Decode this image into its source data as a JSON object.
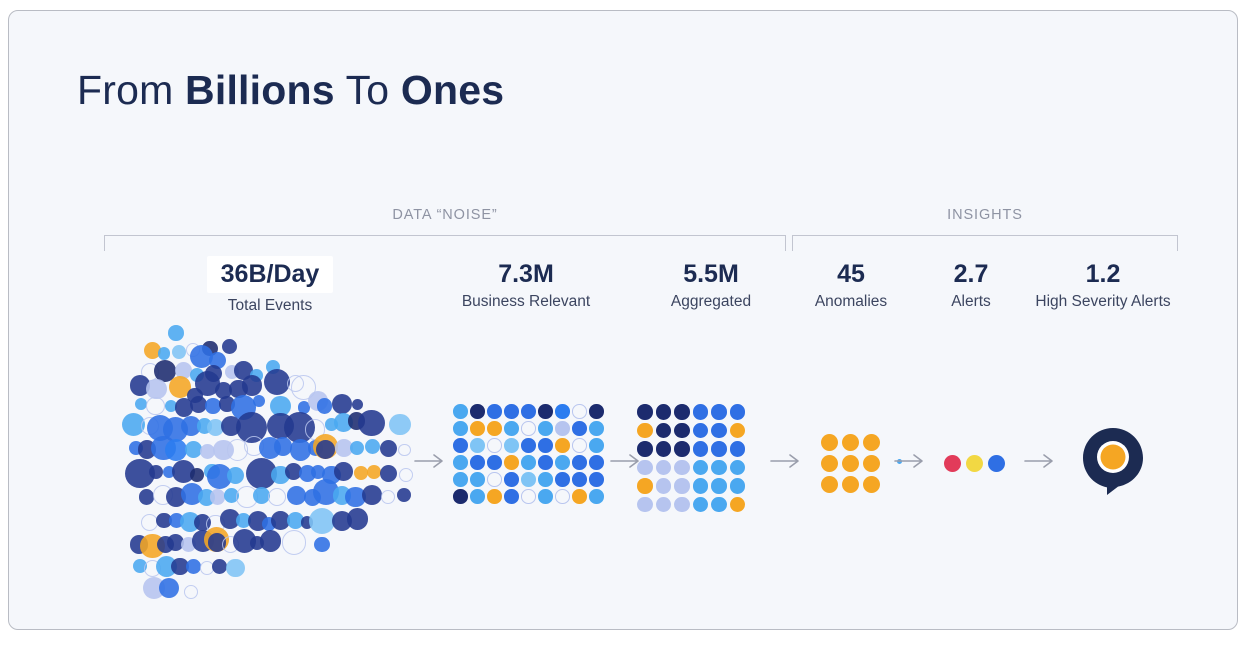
{
  "slide": {
    "title_prefix": "From ",
    "title_bold_1": "Billions",
    "title_middle": " To ",
    "title_bold_2": "Ones",
    "background_color": "#f5f7fb",
    "border_color": "#b9bcc4",
    "title_color": "#1c2b52"
  },
  "groups": [
    {
      "label": "DATA “NOISE”"
    },
    {
      "label": "INSIGHTS"
    }
  ],
  "stats": [
    {
      "value": "36B/Day",
      "caption": "Total Events",
      "highlighted": true
    },
    {
      "value": "7.3M",
      "caption": "Business Relevant",
      "highlighted": false
    },
    {
      "value": "5.5M",
      "caption": "Aggregated",
      "highlighted": false
    },
    {
      "value": "45",
      "caption": "Anomalies",
      "highlighted": false
    },
    {
      "value": "2.7",
      "caption": "Alerts",
      "highlighted": false
    },
    {
      "value": "1.2",
      "caption": "High Severity Alerts",
      "highlighted": false
    }
  ],
  "palette": {
    "navy_dark": "#1c2b6e",
    "navy": "#23398f",
    "blue": "#2f6fe4",
    "blue_bright": "#2b7cf0",
    "sky": "#4aa8f0",
    "sky_light": "#7fc4f5",
    "lavender": "#b6c4ef",
    "orange": "#f5a623",
    "orange_light": "#f7b544",
    "yellow": "#f2d843",
    "red": "#e23b5a",
    "outline": "#b9c6ef",
    "white": "#ffffff",
    "arrow_gray": "#9a9eac",
    "bracket_gray": "#c2c5d0",
    "label_gray": "#8e93a3"
  },
  "icons": {
    "arrow": "arrow-right-icon",
    "logo": "anodot-logo-icon"
  },
  "chart_data": {
    "type": "funnel-dot-diagram",
    "title": "From Billions To Ones",
    "stages": [
      {
        "name": "Total Events",
        "label": "36B/Day",
        "dots_shown": 240,
        "group": "DATA “NOISE”",
        "shape": "scatter-cloud"
      },
      {
        "name": "Business Relevant",
        "label": "7.3M",
        "dots_shown": 54,
        "group": "DATA “NOISE”",
        "shape": "grid-9x6"
      },
      {
        "name": "Aggregated",
        "label": "5.5M",
        "dots_shown": 36,
        "group": "DATA “NOISE”",
        "shape": "grid-6x6"
      },
      {
        "name": "Anomalies",
        "label": "45",
        "dots_shown": 9,
        "group": "INSIGHTS",
        "shape": "grid-3x3"
      },
      {
        "name": "Alerts",
        "label": "2.7",
        "dots_shown": 3,
        "group": "INSIGHTS",
        "shape": "row-3"
      },
      {
        "name": "High Severity Alerts",
        "label": "1.2",
        "dots_shown": 1,
        "group": "INSIGHTS",
        "shape": "logo"
      }
    ],
    "grid_relevant": [
      [
        "sky",
        "navy_dark",
        "blue",
        "blue",
        "blue",
        "navy_dark",
        "blue_bright",
        "outline",
        "navy_dark"
      ],
      [
        "sky",
        "orange",
        "orange",
        "sky",
        "outline",
        "sky",
        "lavender",
        "blue",
        "sky"
      ],
      [
        "blue",
        "sky_light",
        "outline",
        "sky_light",
        "blue",
        "blue",
        "orange",
        "outline",
        "sky"
      ],
      [
        "sky",
        "blue",
        "blue",
        "orange",
        "sky",
        "blue",
        "sky",
        "blue",
        "blue"
      ],
      [
        "sky",
        "sky",
        "outline",
        "blue",
        "sky_light",
        "sky",
        "blue",
        "blue",
        "blue"
      ],
      [
        "navy_dark",
        "sky",
        "orange",
        "blue",
        "outline",
        "sky",
        "outline",
        "orange",
        "sky"
      ]
    ],
    "grid_aggregated": [
      [
        "navy_dark",
        "navy_dark",
        "navy_dark",
        "blue",
        "blue",
        "blue"
      ],
      [
        "orange",
        "navy_dark",
        "navy_dark",
        "blue",
        "blue",
        "orange"
      ],
      [
        "navy_dark",
        "navy_dark",
        "navy_dark",
        "blue",
        "blue",
        "blue"
      ],
      [
        "lavender",
        "lavender",
        "lavender",
        "sky",
        "sky",
        "sky"
      ],
      [
        "orange",
        "lavender",
        "lavender",
        "sky",
        "sky",
        "sky"
      ],
      [
        "lavender",
        "lavender",
        "lavender",
        "sky",
        "sky",
        "orange"
      ]
    ],
    "grid_anomalies": [
      [
        "orange",
        "orange",
        "orange"
      ],
      [
        "orange",
        "orange",
        "orange"
      ],
      [
        "orange",
        "orange",
        "orange"
      ]
    ],
    "dots_alerts": [
      "red",
      "yellow",
      "blue"
    ],
    "cloud_dots": [
      [
        188,
        12,
        10,
        "sky"
      ],
      [
        118,
        32,
        11,
        "orange"
      ],
      [
        152,
        36,
        8,
        "sky"
      ],
      [
        196,
        34,
        9,
        "sky_light"
      ],
      [
        240,
        32,
        9,
        "outline"
      ],
      [
        290,
        30,
        10,
        "navy_dark"
      ],
      [
        348,
        28,
        10,
        "navy"
      ],
      [
        265,
        40,
        15,
        "blue"
      ],
      [
        313,
        44,
        11,
        "blue"
      ],
      [
        110,
        58,
        12,
        "outline"
      ],
      [
        155,
        57,
        14,
        "navy_dark"
      ],
      [
        210,
        56,
        11,
        "lavender"
      ],
      [
        252,
        62,
        9,
        "sky"
      ],
      [
        300,
        60,
        11,
        "navy"
      ],
      [
        354,
        58,
        9,
        "lavender"
      ],
      [
        390,
        56,
        12,
        "navy"
      ],
      [
        428,
        62,
        8,
        "sky"
      ],
      [
        478,
        52,
        9,
        "sky"
      ],
      [
        80,
        74,
        13,
        "navy"
      ],
      [
        130,
        78,
        13,
        "lavender"
      ],
      [
        200,
        76,
        14,
        "orange"
      ],
      [
        245,
        86,
        10,
        "navy"
      ],
      [
        282,
        72,
        16,
        "navy"
      ],
      [
        330,
        80,
        11,
        "navy"
      ],
      [
        374,
        78,
        12,
        "navy"
      ],
      [
        414,
        74,
        13,
        "navy"
      ],
      [
        490,
        70,
        17,
        "navy"
      ],
      [
        546,
        72,
        11,
        "outline"
      ],
      [
        568,
        76,
        16,
        "outline"
      ],
      [
        83,
        96,
        8,
        "sky"
      ],
      [
        126,
        98,
        12,
        "outline"
      ],
      [
        174,
        98,
        8,
        "sky"
      ],
      [
        212,
        100,
        12,
        "navy"
      ],
      [
        255,
        96,
        11,
        "navy"
      ],
      [
        298,
        98,
        10,
        "blue"
      ],
      [
        340,
        96,
        10,
        "navy"
      ],
      [
        390,
        100,
        16,
        "blue"
      ],
      [
        436,
        92,
        8,
        "blue"
      ],
      [
        500,
        98,
        13,
        "sky"
      ],
      [
        570,
        100,
        8,
        "blue"
      ],
      [
        612,
        92,
        13,
        "lavender"
      ],
      [
        632,
        98,
        10,
        "blue"
      ],
      [
        684,
        96,
        13,
        "navy"
      ],
      [
        730,
        96,
        7,
        "navy"
      ],
      [
        62,
        120,
        15,
        "sky"
      ],
      [
        110,
        122,
        12,
        "outline"
      ],
      [
        140,
        124,
        17,
        "blue"
      ],
      [
        186,
        126,
        16,
        "blue"
      ],
      [
        232,
        122,
        13,
        "blue"
      ],
      [
        273,
        122,
        10,
        "sky"
      ],
      [
        306,
        124,
        11,
        "sky_light"
      ],
      [
        352,
        122,
        13,
        "navy"
      ],
      [
        412,
        124,
        20,
        "navy"
      ],
      [
        500,
        122,
        17,
        "navy"
      ],
      [
        556,
        124,
        20,
        "navy"
      ],
      [
        604,
        126,
        13,
        "outline"
      ],
      [
        652,
        120,
        8,
        "sky"
      ],
      [
        688,
        118,
        12,
        "sky"
      ],
      [
        728,
        116,
        11,
        "navy_dark"
      ],
      [
        772,
        118,
        17,
        "navy"
      ],
      [
        856,
        120,
        14,
        "sky_light"
      ],
      [
        68,
        148,
        9,
        "blue"
      ],
      [
        102,
        150,
        12,
        "navy"
      ],
      [
        150,
        148,
        16,
        "blue"
      ],
      [
        188,
        150,
        14,
        "blue_bright"
      ],
      [
        240,
        150,
        11,
        "sky"
      ],
      [
        282,
        152,
        10,
        "lavender"
      ],
      [
        330,
        150,
        13,
        "lavender"
      ],
      [
        372,
        150,
        14,
        "outline"
      ],
      [
        422,
        146,
        13,
        "outline"
      ],
      [
        468,
        148,
        14,
        "blue"
      ],
      [
        508,
        146,
        12,
        "blue"
      ],
      [
        560,
        150,
        14,
        "blue"
      ],
      [
        604,
        148,
        10,
        "blue"
      ],
      [
        634,
        146,
        16,
        "orange"
      ],
      [
        634,
        150,
        12,
        "navy"
      ],
      [
        690,
        148,
        12,
        "lavender"
      ],
      [
        728,
        148,
        9,
        "sky"
      ],
      [
        774,
        146,
        10,
        "sky"
      ],
      [
        822,
        148,
        11,
        "navy"
      ],
      [
        870,
        150,
        8,
        "outline"
      ],
      [
        80,
        178,
        19,
        "navy"
      ],
      [
        128,
        176,
        9,
        "navy"
      ],
      [
        168,
        176,
        8,
        "blue"
      ],
      [
        210,
        176,
        15,
        "navy"
      ],
      [
        250,
        180,
        9,
        "navy_dark"
      ],
      [
        296,
        176,
        10,
        "sky"
      ],
      [
        318,
        182,
        16,
        "blue"
      ],
      [
        366,
        180,
        11,
        "sky"
      ],
      [
        442,
        178,
        20,
        "navy"
      ],
      [
        500,
        180,
        12,
        "sky"
      ],
      [
        540,
        176,
        11,
        "navy"
      ],
      [
        580,
        178,
        11,
        "blue"
      ],
      [
        612,
        176,
        9,
        "blue"
      ],
      [
        652,
        180,
        12,
        "blue"
      ],
      [
        688,
        176,
        12,
        "navy"
      ],
      [
        740,
        178,
        9,
        "orange"
      ],
      [
        780,
        176,
        9,
        "orange"
      ],
      [
        822,
        178,
        11,
        "navy"
      ],
      [
        874,
        180,
        9,
        "outline"
      ],
      [
        100,
        206,
        10,
        "navy"
      ],
      [
        150,
        204,
        13,
        "outline"
      ],
      [
        188,
        206,
        13,
        "navy"
      ],
      [
        236,
        202,
        14,
        "blue"
      ],
      [
        278,
        206,
        11,
        "sky"
      ],
      [
        312,
        206,
        10,
        "lavender"
      ],
      [
        354,
        204,
        10,
        "sky"
      ],
      [
        400,
        206,
        14,
        "outline"
      ],
      [
        444,
        204,
        11,
        "sky"
      ],
      [
        490,
        206,
        12,
        "outline"
      ],
      [
        548,
        204,
        12,
        "blue"
      ],
      [
        596,
        206,
        11,
        "blue"
      ],
      [
        636,
        200,
        17,
        "blue"
      ],
      [
        684,
        204,
        12,
        "sky"
      ],
      [
        724,
        206,
        13,
        "blue"
      ],
      [
        772,
        204,
        13,
        "navy"
      ],
      [
        820,
        206,
        9,
        "outline"
      ],
      [
        868,
        204,
        9,
        "navy"
      ],
      [
        110,
        236,
        11,
        "outline"
      ],
      [
        152,
        234,
        10,
        "navy"
      ],
      [
        190,
        234,
        10,
        "blue"
      ],
      [
        230,
        236,
        13,
        "sky"
      ],
      [
        268,
        236,
        11,
        "navy"
      ],
      [
        306,
        238,
        12,
        "outline"
      ],
      [
        348,
        232,
        13,
        "navy"
      ],
      [
        390,
        234,
        10,
        "sky"
      ],
      [
        434,
        234,
        13,
        "navy"
      ],
      [
        466,
        238,
        9,
        "blue"
      ],
      [
        500,
        234,
        12,
        "navy"
      ],
      [
        544,
        234,
        11,
        "sky"
      ],
      [
        580,
        236,
        8,
        "navy"
      ],
      [
        624,
        234,
        17,
        "sky_light"
      ],
      [
        684,
        234,
        13,
        "navy"
      ],
      [
        730,
        232,
        14,
        "navy"
      ],
      [
        78,
        262,
        12,
        "navy"
      ],
      [
        118,
        264,
        16,
        "orange"
      ],
      [
        158,
        262,
        11,
        "navy"
      ],
      [
        186,
        260,
        11,
        "navy"
      ],
      [
        226,
        262,
        10,
        "lavender"
      ],
      [
        268,
        258,
        14,
        "navy"
      ],
      [
        310,
        256,
        16,
        "orange"
      ],
      [
        310,
        260,
        12,
        "navy"
      ],
      [
        352,
        262,
        11,
        "outline"
      ],
      [
        392,
        258,
        15,
        "navy"
      ],
      [
        430,
        260,
        9,
        "navy"
      ],
      [
        470,
        258,
        14,
        "navy"
      ],
      [
        540,
        260,
        16,
        "outline"
      ],
      [
        624,
        262,
        10,
        "blue"
      ],
      [
        82,
        288,
        9,
        "sky"
      ],
      [
        118,
        290,
        11,
        "outline"
      ],
      [
        160,
        288,
        14,
        "sky"
      ],
      [
        200,
        288,
        11,
        "navy"
      ],
      [
        240,
        288,
        10,
        "blue"
      ],
      [
        282,
        290,
        9,
        "outline"
      ],
      [
        318,
        288,
        10,
        "navy"
      ],
      [
        366,
        290,
        12,
        "sky_light"
      ],
      [
        122,
        314,
        14,
        "lavender"
      ],
      [
        168,
        314,
        13,
        "blue"
      ],
      [
        232,
        318,
        9,
        "outline"
      ]
    ]
  }
}
